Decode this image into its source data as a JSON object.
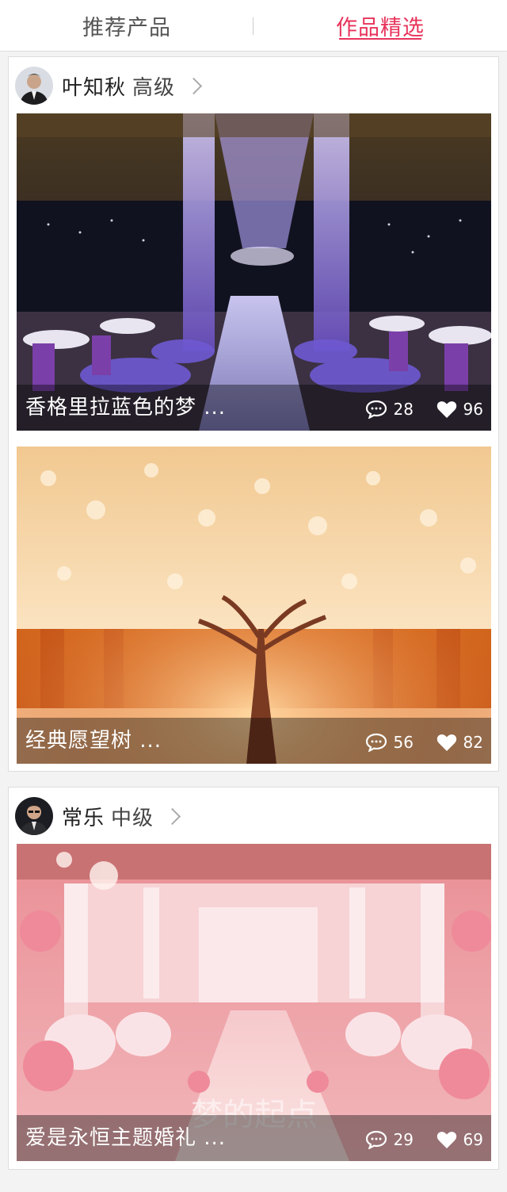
{
  "tabs": {
    "recommended": "推荐产品",
    "featured": "作品精选"
  },
  "colors": {
    "accent": "#e8335b"
  },
  "cards": [
    {
      "author": {
        "name": "叶知秋",
        "level": "高级"
      },
      "works": [
        {
          "title": "香格里拉蓝色的梦 ...",
          "comments": "28",
          "likes": "96"
        },
        {
          "title": "经典愿望树 ...",
          "comments": "56",
          "likes": "82"
        }
      ]
    },
    {
      "author": {
        "name": "常乐",
        "level": "中级"
      },
      "works": [
        {
          "title": "爱是永恒主题婚礼 ...",
          "comments": "29",
          "likes": "69"
        }
      ]
    }
  ],
  "icons": {
    "comment": "comment-bubble-icon",
    "like": "heart-icon",
    "more": "chevron-right-icon"
  }
}
